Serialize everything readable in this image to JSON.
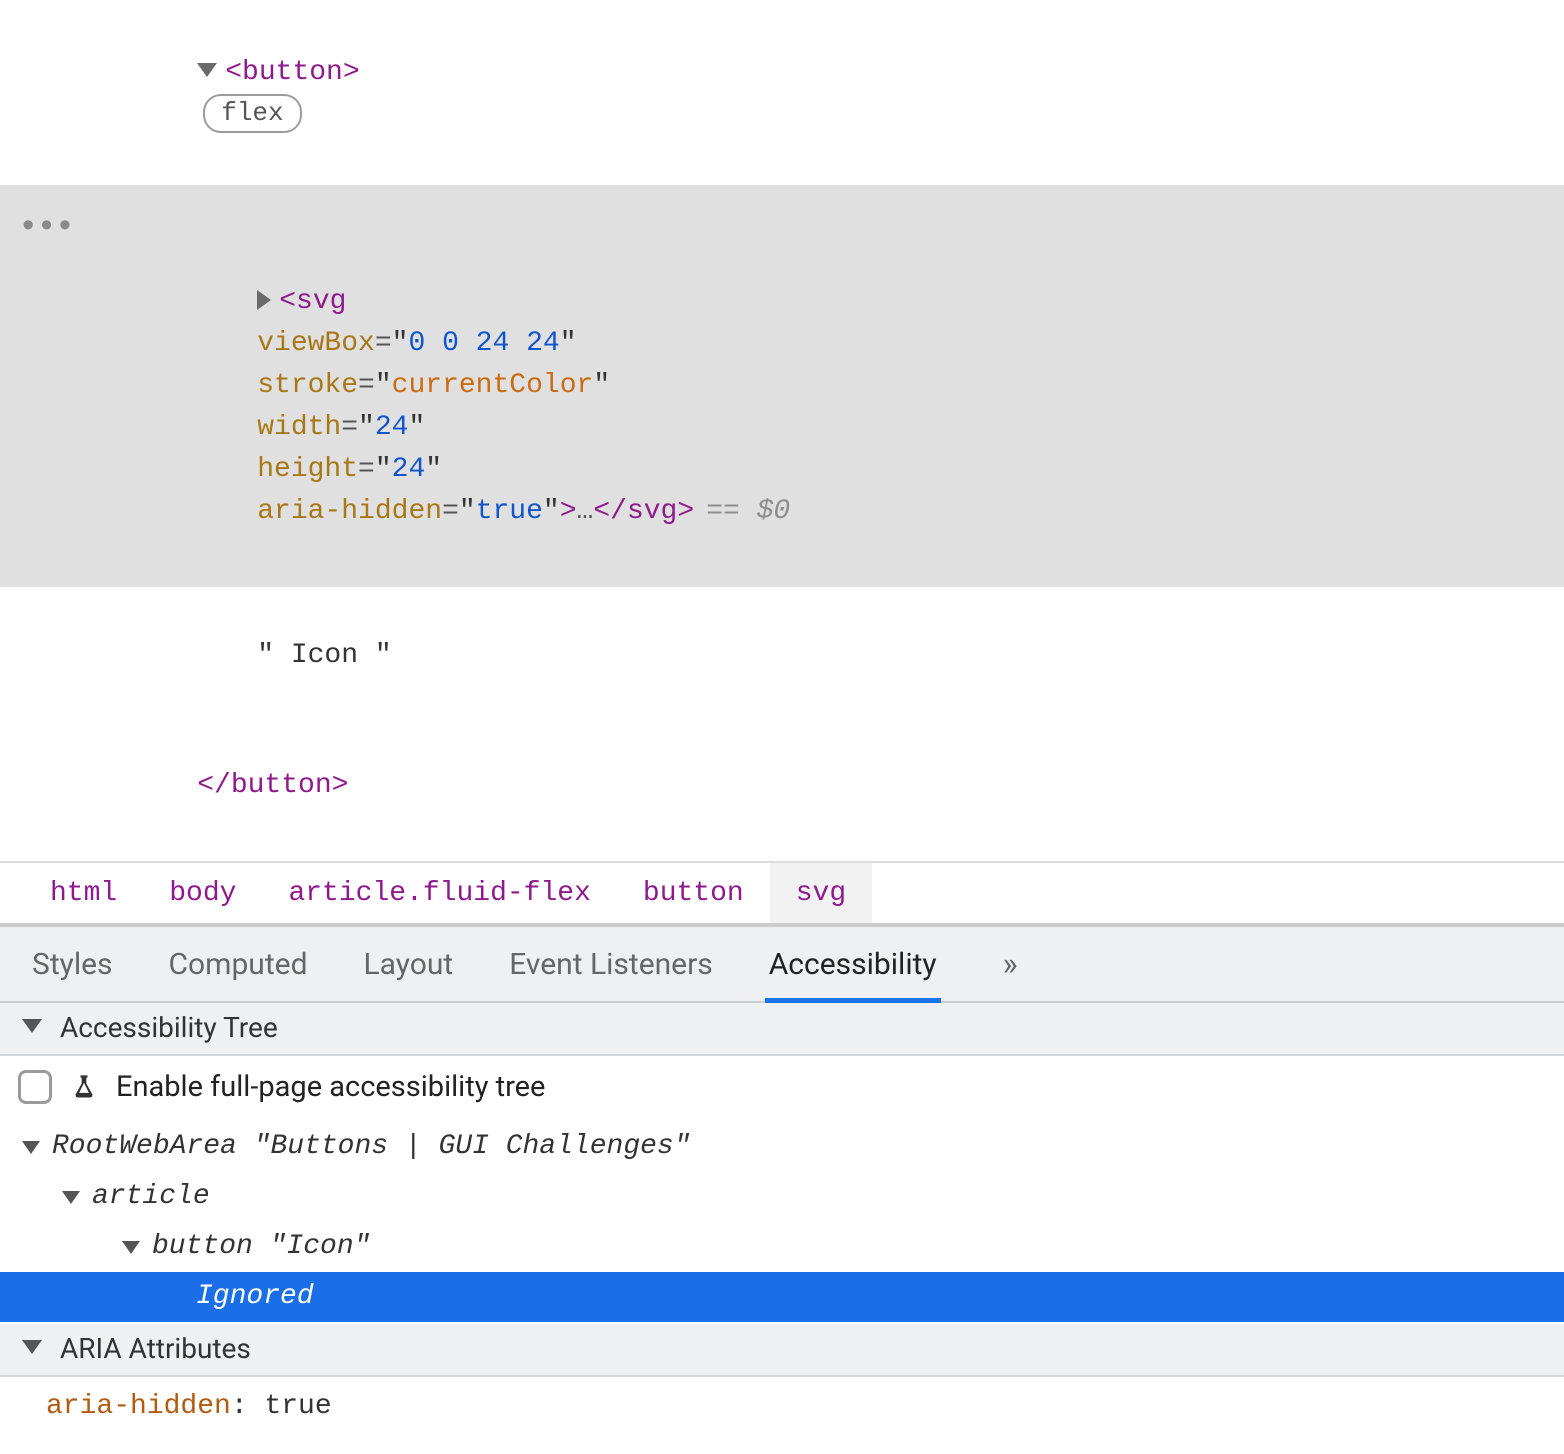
{
  "elements": {
    "button_open": {
      "tag": "button",
      "flex_badge": "flex"
    },
    "svg_line": {
      "tag": "svg",
      "attr_viewBox_name": "viewBox",
      "attr_viewBox_value": "0 0 24 24",
      "attr_stroke_name": "stroke",
      "attr_stroke_value": "currentColor",
      "attr_width_name": "width",
      "attr_width_value": "24",
      "attr_height_name": "height",
      "attr_height_value": "24",
      "attr_ariahidden_name": "aria-hidden",
      "attr_ariahidden_value": "true",
      "ellipsis": "…",
      "close_tag": "svg",
      "eq_ref": "== $0"
    },
    "text_node": "\" Icon \"",
    "button_close": "button"
  },
  "breadcrumb": {
    "items": [
      "html",
      "body",
      "article.fluid-flex",
      "button",
      "svg"
    ],
    "active_index": 4
  },
  "details_tabs": {
    "items": [
      "Styles",
      "Computed",
      "Layout",
      "Event Listeners",
      "Accessibility"
    ],
    "active_index": 4,
    "more_glyph": "»"
  },
  "a11y_panel": {
    "section_title": "Accessibility Tree",
    "enable_label": "Enable full-page accessibility tree",
    "tree": {
      "root_role": "RootWebArea",
      "root_name": "\"Buttons | GUI Challenges\"",
      "article_role": "article",
      "button_role": "button",
      "button_name": "\"Icon\"",
      "ignored_label": "Ignored"
    }
  },
  "aria_section": {
    "title": "ARIA Attributes",
    "attr_name": "aria-hidden",
    "attr_value": "true"
  }
}
